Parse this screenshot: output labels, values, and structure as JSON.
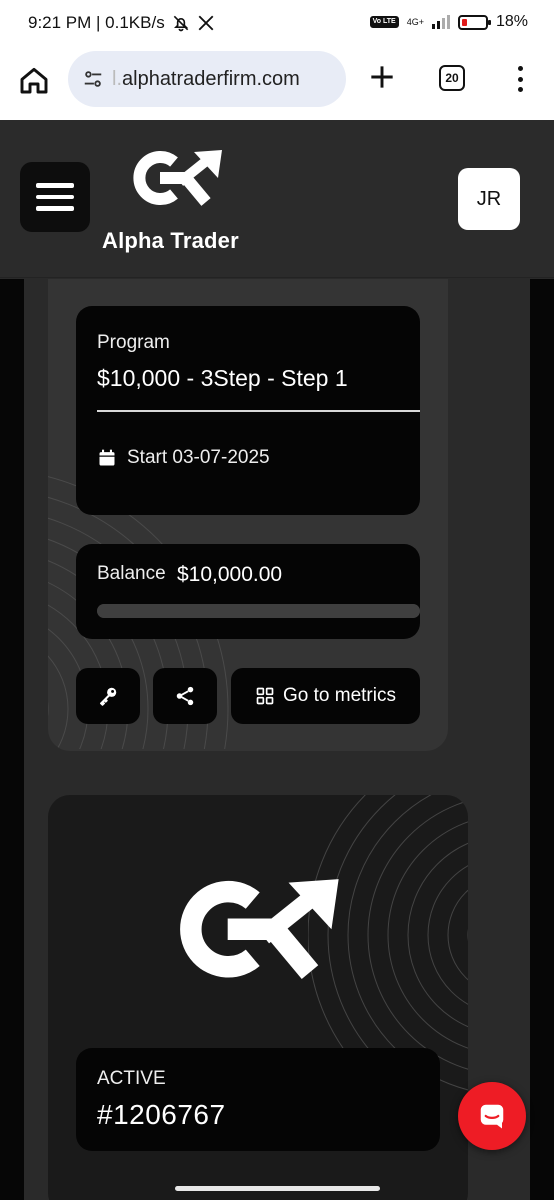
{
  "status_bar": {
    "time_speed": "9:21 PM | 0.1KB/s",
    "network": "4G+",
    "battery_percent": "18%",
    "volte": "Vo LTE",
    "icons": [
      "alarm-off-icon",
      "x-logo-icon",
      "signal-icon",
      "battery-icon"
    ]
  },
  "browser": {
    "url_prefix": "l.",
    "url_domain": "alphatraderfirm.com",
    "tab_count": "20",
    "icons": [
      "home-icon",
      "tune-icon",
      "plus-icon",
      "more-vert-icon"
    ]
  },
  "header": {
    "brand": "Alpha Trader",
    "avatar_initials": "JR",
    "icons": [
      "menu-icon",
      "alpha-trader-logo"
    ]
  },
  "account_card": {
    "program_label": "Program",
    "program_value": "$10,000 - 3Step - Step 1",
    "start_text": "Start 03-07-2025",
    "balance_label": "Balance",
    "balance_value": "$10,000.00",
    "balance_progress_fraction": 1.0,
    "metrics_label": "Go to metrics",
    "icons": [
      "calendar-icon",
      "key-icon",
      "share-icon",
      "grid-icon"
    ]
  },
  "second_card": {
    "status_label": "ACTIVE",
    "account_id": "#1206767"
  },
  "colors": {
    "page_bg": "#2a2a2a",
    "card_bg": "#343434",
    "box_bg": "#050505",
    "chat_red": "#ee1c25"
  }
}
